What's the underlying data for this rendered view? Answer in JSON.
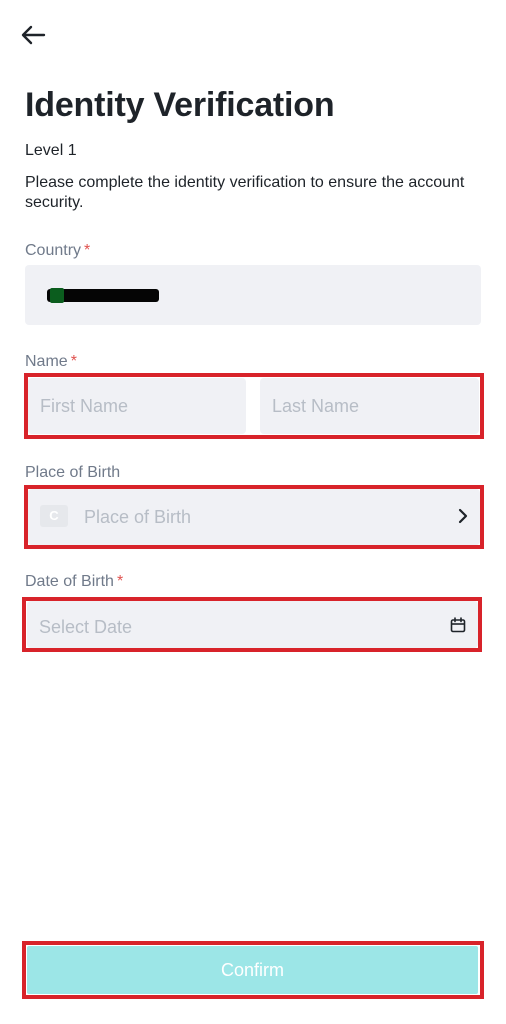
{
  "header": {
    "title": "Identity Verification",
    "level": "Level 1",
    "description": "Please complete the identity verification to ensure the account security."
  },
  "form": {
    "country": {
      "label": "Country",
      "required": "*",
      "value_redacted": true
    },
    "name": {
      "label": "Name",
      "required": "*",
      "first_placeholder": "First Name",
      "last_placeholder": "Last Name"
    },
    "place_of_birth": {
      "label": "Place of Birth",
      "placeholder": "Place of Birth",
      "letter": "C"
    },
    "date_of_birth": {
      "label": "Date of Birth",
      "required": "*",
      "placeholder": "Select Date"
    }
  },
  "footer": {
    "confirm_label": "Confirm"
  },
  "colors": {
    "accent_disabled": "#9ce6e7",
    "required_mark": "#e0524f",
    "highlight_outline": "#d8232a",
    "field_background": "#f0f1f5"
  },
  "icons": [
    "back-arrow-icon",
    "chevron-right-icon",
    "calendar-icon"
  ]
}
